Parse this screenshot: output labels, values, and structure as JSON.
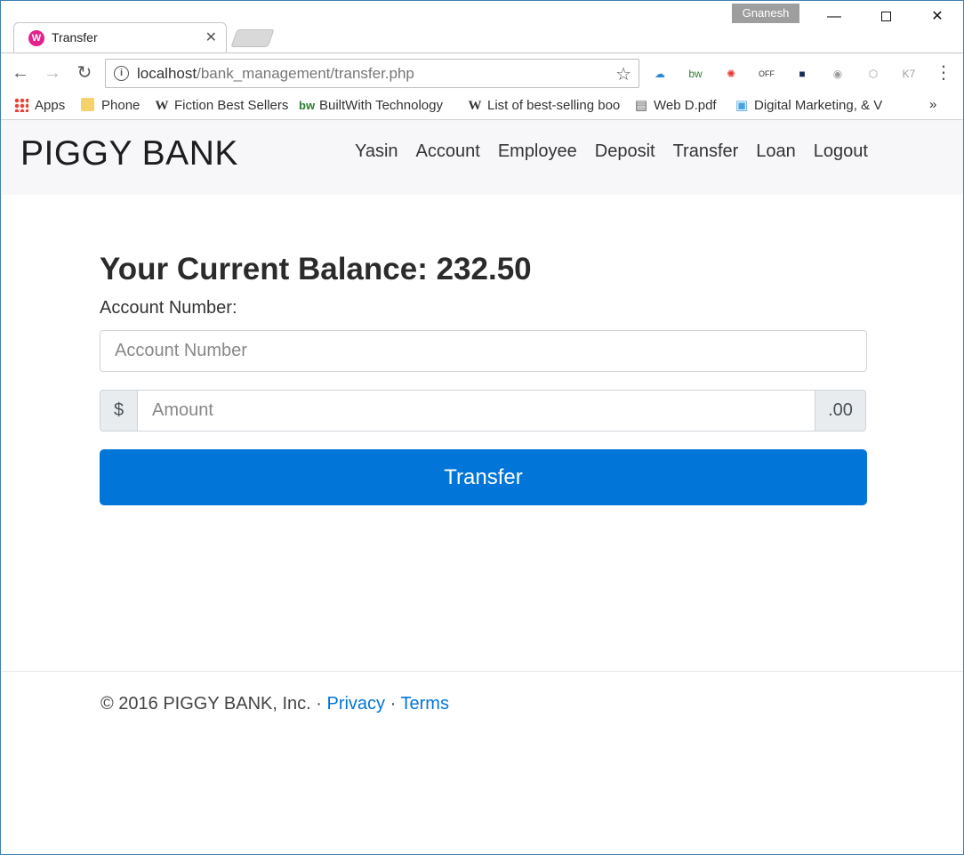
{
  "browser": {
    "tab_title": "Transfer",
    "tab_favicon": "W",
    "profile_name": "Gnanesh",
    "url_host": "localhost",
    "url_path": "/bank_management/transfer.php",
    "extensions": [
      {
        "name": "onedrive-icon",
        "glyph": "☁",
        "color": "#2b88d8"
      },
      {
        "name": "builtwith-icon",
        "glyph": "bw",
        "color": "#2e7d32"
      },
      {
        "name": "color-wheel-icon",
        "glyph": "✺",
        "color": "#e53935"
      },
      {
        "name": "off-icon",
        "glyph": "OFF",
        "color": "#333333"
      },
      {
        "name": "dark-square-icon",
        "glyph": "■",
        "color": "#1a2a5a"
      },
      {
        "name": "globe-icon",
        "glyph": "◉",
        "color": "#9e9e9e"
      },
      {
        "name": "cube-icon",
        "glyph": "⬡",
        "color": "#9e9e9e"
      },
      {
        "name": "k7-icon",
        "glyph": "K7",
        "color": "#9e9e9e"
      }
    ]
  },
  "bookmarks": {
    "apps": "Apps",
    "phone": "Phone",
    "fiction": "Fiction Best Sellers",
    "builtwith": "BuiltWith Technology",
    "bestselling": "List of best-selling boo",
    "webd": "Web D.pdf",
    "digital": "Digital Marketing, & V"
  },
  "site": {
    "brand": "PIGGY BANK",
    "nav": [
      "Yasin",
      "Account",
      "Employee",
      "Deposit",
      "Transfer",
      "Loan",
      "Logout"
    ]
  },
  "form": {
    "balance_heading": "Your Current Balance: 232.50",
    "account_label": "Account Number:",
    "account_placeholder": "Account Number",
    "currency_prefix": "$",
    "amount_placeholder": "Amount",
    "amount_suffix": ".00",
    "submit_label": "Transfer"
  },
  "footer": {
    "copyright": "© 2016 PIGGY BANK, Inc. ·",
    "privacy": "Privacy",
    "separator": "·",
    "terms": "Terms"
  }
}
